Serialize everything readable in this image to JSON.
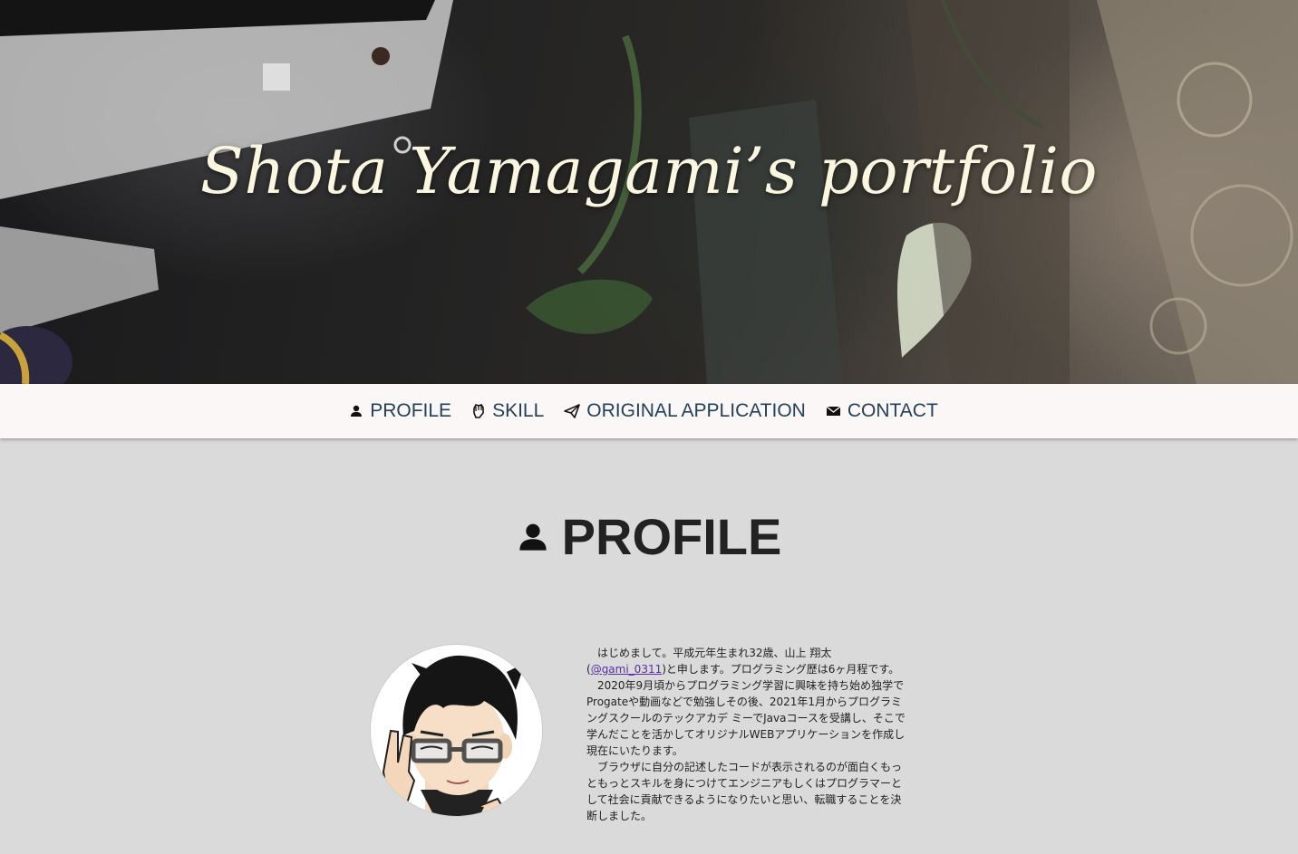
{
  "hero": {
    "title": "Shota Yamagami’s portfolio"
  },
  "nav": {
    "items": [
      {
        "label": "PROFILE",
        "icon": "person-icon"
      },
      {
        "label": "SKILL",
        "icon": "fist-icon"
      },
      {
        "label": "ORIGINAL APPLICATION",
        "icon": "paper-plane-icon"
      },
      {
        "label": "CONTACT",
        "icon": "envelope-icon"
      }
    ]
  },
  "profile": {
    "title": "PROFILE",
    "icon": "person-icon",
    "avatar": "cartoon-avatar",
    "bio": {
      "p1_before": "はじめまして。平成元年生まれ32歳、山上 翔太(",
      "p1_link": "@gami_0311",
      "p1_after": ")と申します。プログラミング歴は6ヶ月程です。",
      "p2": "2020年9月頃からプログラミング学習に興味を持ち始め独学でProgateや動画などで勉強しその後、2021年1月からプログラミングスクールのテックアカデ ミーでJavaコースを受講し、そこで学んだことを活かしてオリジナルWEBアプリケーションを作成し現在にいたります。",
      "p3": "ブラウザに自分の記述したコードが表示されるのが面白くもっともっとスキルを身につけてエンジニアもしくはプログラマーとして社会に貢献できるようになりたいと思い、転職することを決断しました。"
    }
  },
  "colors": {
    "nav_bg": "#fbf7f7",
    "nav_text": "#23415a",
    "page_bg": "#dadada",
    "title_text": "#fbf6e0"
  }
}
